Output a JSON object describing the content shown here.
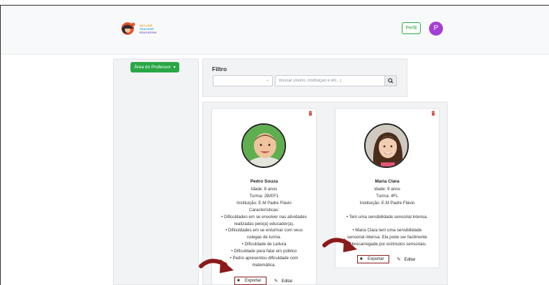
{
  "header": {
    "logo_lines": [
      "INCLUDE",
      "TRACKER",
      "EDUCATION"
    ],
    "profile_button": "Perfil",
    "avatar_initial": "P"
  },
  "sidebar": {
    "area_button": "Área do Professor",
    "caret": "▾"
  },
  "filter": {
    "title": "Filtro",
    "select_value": "",
    "search_placeholder": "Buscar (Aluno, instituição e etc...)"
  },
  "students": [
    {
      "name": "Pedro Souza",
      "details": [
        "Idade: 8 anos",
        "Turma: 2B/EF1",
        "Instituição: E.M Padre Flávio",
        "Características:",
        "• Dificuldades em se envolver nas atividades",
        "realizadas pelo(a) educador(a).",
        "• Dificuldades em se enturmar com seus",
        "colegas de turma.",
        "• Dificuldade de Leitura",
        "• Dificuldade para falar em público",
        "• Pedro apresentou dificuldade com",
        "matemática."
      ],
      "export_label": "Exportar",
      "edit_label": "Editar"
    },
    {
      "name": "Maria Clara",
      "details": [
        "Idade: 9 anos",
        "Turma: 4FL",
        "Instituição: E.M Padre Flávio",
        "",
        "• Tem uma sensibilidade sensorial intensa.",
        "",
        "• Maria Clara tem uma sensibilidade",
        "sensorial intensa. Ela pode ser facilmente",
        "sobrecarregada por estímulos sensoriais."
      ],
      "export_label": "Exportar",
      "edit_label": "Editar"
    }
  ],
  "colors": {
    "primary_green": "#28a745",
    "avatar_purple": "#a43fd6",
    "highlight_red": "#8b1a1a",
    "delete_red": "#d9534f"
  }
}
